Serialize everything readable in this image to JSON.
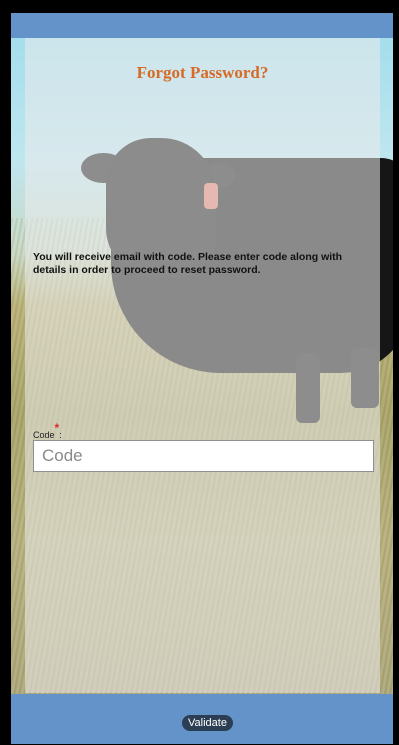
{
  "header": {
    "title": "Forgot Password?"
  },
  "main": {
    "info_text": "You will receive email with code. Please enter code along with details in order to proceed to reset password.",
    "code_label": "Code",
    "required_mark": "*",
    "label_suffix": ":",
    "code_placeholder": "Code",
    "code_value": ""
  },
  "footer": {
    "validate_label": "Validate"
  },
  "colors": {
    "bar": "#6393c8",
    "title": "#d86a27",
    "required": "#e0282a",
    "button": "#2c3e53"
  }
}
